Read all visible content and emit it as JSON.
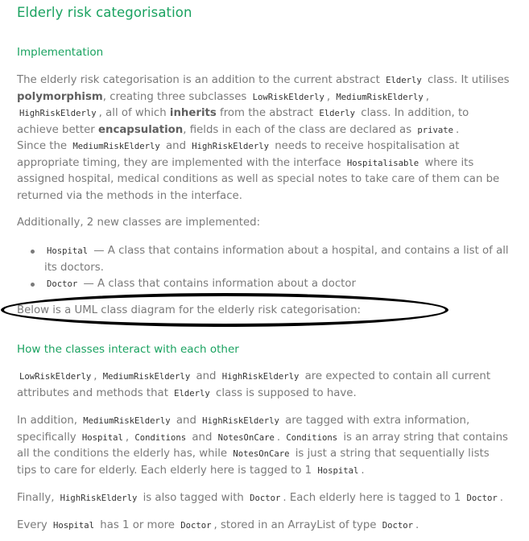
{
  "title": "Elderly risk categorisation",
  "implementation": {
    "heading": "Implementation",
    "p1": {
      "s1": "The elderly risk categorisation is an addition to the current abstract",
      "c_elderly": "Elderly",
      "s2": "class. It utilises",
      "b_poly": "polymorphism",
      "s3": ", creating three subclasses",
      "c_low": "LowRiskElderly",
      "sep1": ",",
      "c_med": "MediumRiskElderly",
      "sep2": ",",
      "c_high": "HighRiskElderly",
      "s4": ", all of which",
      "b_inherits": "inherits",
      "s5": "from the abstract",
      "c_elderly2": "Elderly",
      "s6": "class. In addition, to achieve better",
      "b_encap": "encapsulation",
      "s7": ", fields in each of the class are declared as",
      "c_private": "private",
      "s8": "."
    },
    "p2": {
      "s1": "Since the",
      "c_med": "MediumRiskElderly",
      "s2": "and",
      "c_high": "HighRiskElderly",
      "s3": "needs to receive hospitalisation at appropriate timing, they are implemented with the interface",
      "c_hosp": "Hospitalisable",
      "s4": "where its assigned hospital, medical conditions as well as special notes to take care of them can be returned via the methods in the interface."
    },
    "p3": "Additionally, 2 new classes are implemented:",
    "list": [
      {
        "code": "Hospital",
        "text": "— A class that contains information about a hospital, and contains a list of all its doctors."
      },
      {
        "code": "Doctor",
        "text": "— A class that contains information about a doctor"
      }
    ],
    "p4": "Below is a UML class diagram for the elderly risk categorisation:"
  },
  "interact": {
    "heading": "How the classes interact with each other",
    "p1": {
      "c_low": "LowRiskElderly",
      "sep1": ",",
      "c_med": "MediumRiskElderly",
      "s1": "and",
      "c_high": "HighRiskElderly",
      "s2": "are expected to contain all current attributes and methods that",
      "c_elderly": "Elderly",
      "s3": "class is supposed to have."
    },
    "p2": {
      "s1": "In addition,",
      "c_med": "MediumRiskElderly",
      "s2": "and",
      "c_high": "HighRiskElderly",
      "s3": "are tagged with extra information, specifically",
      "c_hosp": "Hospital",
      "sep1": ",",
      "c_cond": "Conditions",
      "s4": "and",
      "c_notes": "NotesOnCare",
      "sep2": ".",
      "c_cond2": "Conditions",
      "s5": "is an array string that contains all the conditions the elderly has, while",
      "c_notes2": "NotesOnCare",
      "s6": "is just a string that sequentially lists tips to care for elderly. Each elderly here is tagged to 1",
      "c_hosp2": "Hospital",
      "s7": "."
    },
    "p3": {
      "s1": "Finally,",
      "c_high": "HighRiskElderly",
      "s2": "is also tagged with",
      "c_doc": "Doctor",
      "s3": ". Each elderly here is tagged to 1",
      "c_doc2": "Doctor",
      "s4": "."
    },
    "p4": {
      "s1": "Every",
      "c_hosp": "Hospital",
      "s2": "has 1 or more",
      "c_doc": "Doctor",
      "s3": ", stored in an ArrayList of type",
      "c_doc2": "Doctor",
      "s4": "."
    }
  },
  "colors": {
    "heading": "#1aa260",
    "text": "#7a7a7a",
    "code": "#333333",
    "annotation": "#000000"
  }
}
